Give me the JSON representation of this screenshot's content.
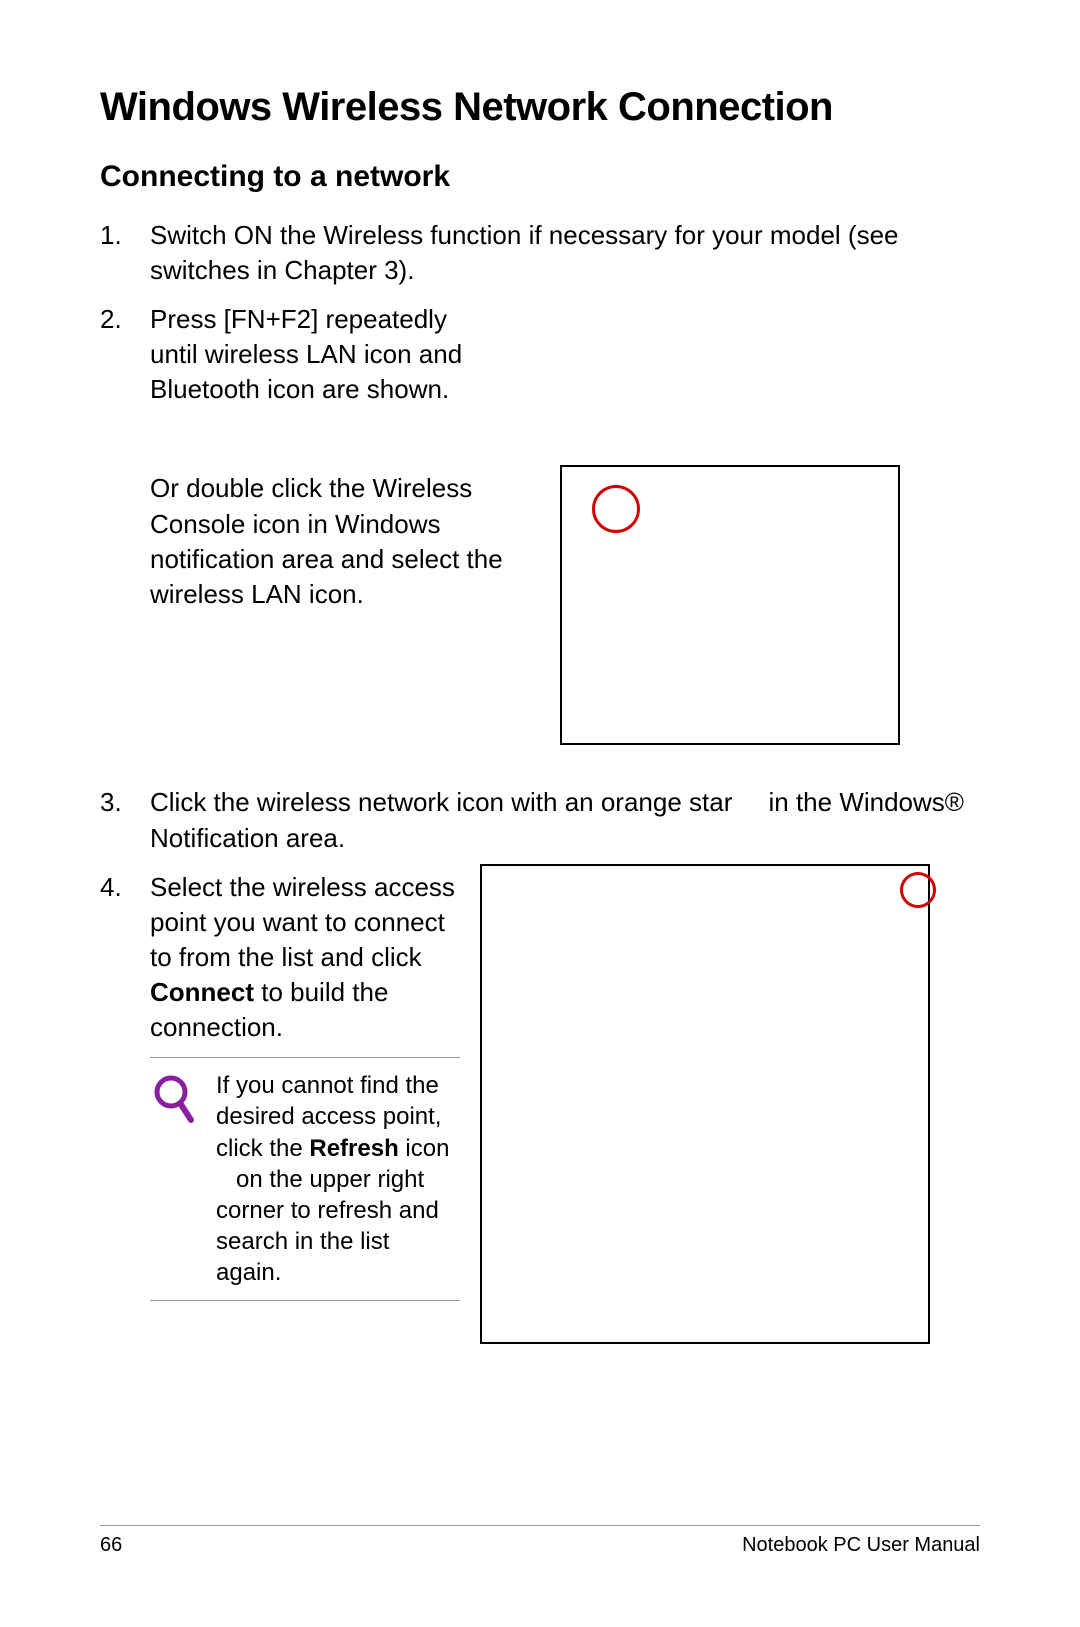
{
  "title": "Windows Wireless Network Connection",
  "subtitle": "Connecting to a network",
  "steps": {
    "s1": {
      "num": "1.",
      "text": "Switch ON the Wireless function if necessary for your model (see switches in Chapter 3)."
    },
    "s2": {
      "num": "2.",
      "text_a": "Press [FN+F2] repeatedly until wireless LAN icon and Bluetooth icon are shown.",
      "text_b": "Or double click the Wireless Console icon in Windows notification area and select the wireless LAN icon."
    },
    "s3": {
      "num": "3.",
      "text_a": "Click the wireless network icon with an orange star ",
      "text_b": " in the Windows® Notification area."
    },
    "s4": {
      "num": "4.",
      "text_a": "Select the wireless access point you want to connect to from the list and click ",
      "bold": "Connect",
      "text_b": " to build the connection."
    }
  },
  "note": {
    "pre": "If you cannot find the desired access point, click the ",
    "bold": "Refresh",
    "mid": " icon ",
    "post": " on the upper right corner to refresh and search in the list again."
  },
  "footer": {
    "page": "66",
    "doc": "Notebook PC User Manual"
  }
}
